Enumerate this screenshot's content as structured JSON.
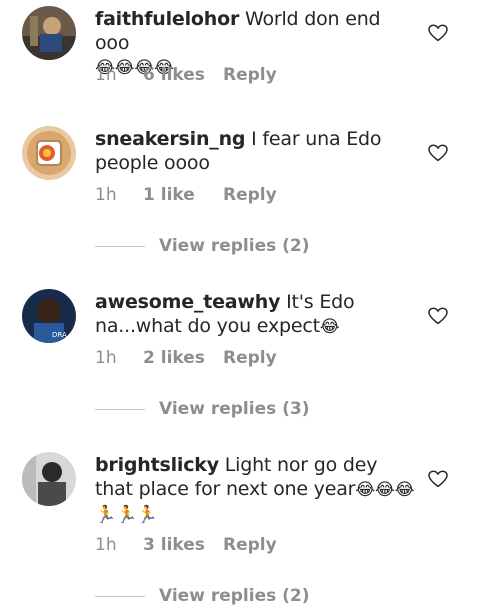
{
  "comments": [
    {
      "username": "faithfulelohor",
      "text": "World don end ooo",
      "emoji": "😂😂😂😂",
      "time": "1h",
      "likes": "6 likes",
      "reply": "Reply",
      "heart_icon": "heart-outline-icon"
    },
    {
      "username": "sneakersin_ng",
      "text": "I fear una Edo people oooo",
      "emoji": "",
      "time": "1h",
      "likes": "1 like",
      "reply": "Reply",
      "view_replies": "View replies (2)",
      "heart_icon": "heart-outline-icon"
    },
    {
      "username": "awesome_teawhy",
      "text": "It's Edo na...what do you expect",
      "emoji": "😂",
      "time": "1h",
      "likes": "2 likes",
      "reply": "Reply",
      "view_replies": "View replies (3)",
      "heart_icon": "heart-outline-icon"
    },
    {
      "username": "brightslicky",
      "text": "Light nor go dey that place for  next one year",
      "emoji": "😂😂😂",
      "emoji2": "🏃🏃🏃",
      "time": "1h",
      "likes": "3 likes",
      "reply": "Reply",
      "view_replies": "View replies (2)",
      "heart_icon": "heart-outline-icon"
    }
  ],
  "colors": {
    "text": "#262626",
    "muted": "#8e8e8e",
    "divider": "#c7c7c7"
  }
}
